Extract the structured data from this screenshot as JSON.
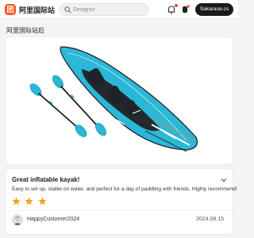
{
  "header": {
    "logo_glyph": "团",
    "brand": "阿里国际站",
    "search": {
      "placeholder": "Designor",
      "icon": "search-icon"
    },
    "notification_icon": "bell-icon",
    "user_icon": "user-icon",
    "action_label": "Sakaraoa cs"
  },
  "shop": {
    "title": "阿里国际站后"
  },
  "product": {
    "image": "inflatable-kayak-with-two-paddles",
    "accent": "#2bb7d6"
  },
  "review": {
    "title": "Great inflatable kayak!",
    "body": "Easy to set up, stable on water, and perfect for a day of paddling with friends. Highly recommend!",
    "rating": 3,
    "rating_max": 3,
    "star_color": "#f2a516",
    "author": "HappyCustomer2024",
    "date": "2024.08.15"
  },
  "colors": {
    "brand": "#ff5a1f",
    "kayak": "#2bb7d6",
    "button": "#1a1a1a"
  }
}
